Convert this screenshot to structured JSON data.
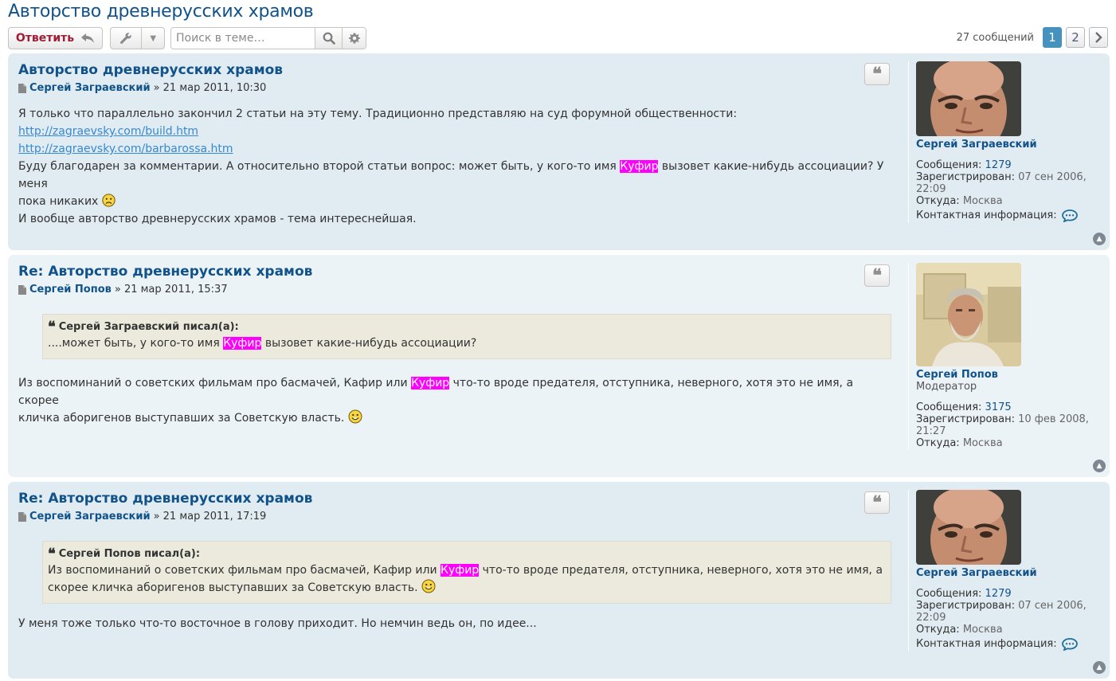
{
  "topic": {
    "title": "Авторство древнерусских храмов"
  },
  "toolbar": {
    "reply_label": "Ответить",
    "search_placeholder": "Поиск в теме…"
  },
  "pagination": {
    "count": "27 сообщений",
    "pages": [
      "1",
      "2"
    ],
    "active": "1"
  },
  "posts": [
    {
      "title": "Авторство древнерусских храмов",
      "author": "Сергей Заграевский",
      "date": "» 21 мар 2011, 10:30",
      "line1": "Я только что параллельно закончил 2 статьи на эту тему. Традиционно представляю на суд форумной общественности:",
      "link1": "http://zagraevsky.com/build.htm",
      "link2": "http://zagraevsky.com/barbarossa.htm",
      "line2a": "Буду благодарен за комментарии. А относительно второй статьи вопрос: может быть, у кого-то имя ",
      "highlight": "Куфир",
      "line2b": " вызовет какие-нибудь ассоциации? У меня",
      "line3": "пока никаких",
      "line4": "И вообще авторство древнерусских храмов - тема интереснейшая.",
      "profile": {
        "name": "Сергей Заграевский",
        "posts_label": "Сообщения:",
        "posts": "1279",
        "reg_label": "Зарегистрирован:",
        "reg": "07 сен 2006,",
        "reg2": "22:09",
        "from_label": "Откуда:",
        "from": "Москва",
        "contact_label": "Контактная информация:"
      }
    },
    {
      "title": "Re: Авторство древнерусских храмов",
      "author": "Сергей Попов",
      "date": "» 21 мар 2011, 15:37",
      "quote_cite": "Сергей Заграевский писал(а):",
      "quote_a": "....может быть, у кого-то имя ",
      "highlight": "Куфир",
      "quote_b": " вызовет какие-нибудь ассоциации?",
      "body_a": "Из воспоминаний о советских фильмам про басмачей, Кафир или ",
      "body_b": " что-то вроде предателя, отступника, неверного, хотя это не имя, а скорее",
      "body_c": "кличка аборигенов выступавших за Советскую власть.",
      "profile": {
        "name": "Сергей Попов",
        "rank": "Модератор",
        "posts_label": "Сообщения:",
        "posts": "3175",
        "reg_label": "Зарегистрирован:",
        "reg": "10 фев 2008,",
        "reg2": "21:27",
        "from_label": "Откуда:",
        "from": "Москва"
      }
    },
    {
      "title": "Re: Авторство древнерусских храмов",
      "author": "Сергей Заграевский",
      "date": "» 21 мар 2011, 17:19",
      "quote_cite": "Сергей Попов писал(а):",
      "quote_a": "Из воспоминаний о советских фильмам про басмачей, Кафир или ",
      "highlight": "Куфир",
      "quote_b": " что-то вроде предателя, отступника, неверного, хотя это не имя, а",
      "quote_c": "скорее кличка аборигенов выступавших за Советскую власть.",
      "body": "У меня тоже только что-то восточное в голову приходит. Но немчин ведь он, по идее...",
      "profile": {
        "name": "Сергей Заграевский",
        "posts_label": "Сообщения:",
        "posts": "1279",
        "reg_label": "Зарегистрирован:",
        "reg": "07 сен 2006,",
        "reg2": "22:09",
        "from_label": "Откуда:",
        "from": "Москва",
        "contact_label": "Контактная информация:"
      }
    }
  ],
  "colors": {
    "title": "#105289",
    "post_bg_a": "#e1ebf2",
    "post_bg_b": "#ecf3f7",
    "highlight": "#ff00ff",
    "reply": "#a01d35",
    "page_active": "#4692bf"
  },
  "icons": {
    "reply": "reply-arrow-icon",
    "tools": "wrench-icon",
    "search": "search-icon",
    "settings": "gear-icon",
    "next": "chevron-right-icon",
    "quote": "quote-icon",
    "post": "file-icon",
    "contact": "speech-bubble-icon",
    "top": "back-to-top-icon",
    "sad": "sad-smiley-icon",
    "smile": "smile-smiley-icon"
  }
}
